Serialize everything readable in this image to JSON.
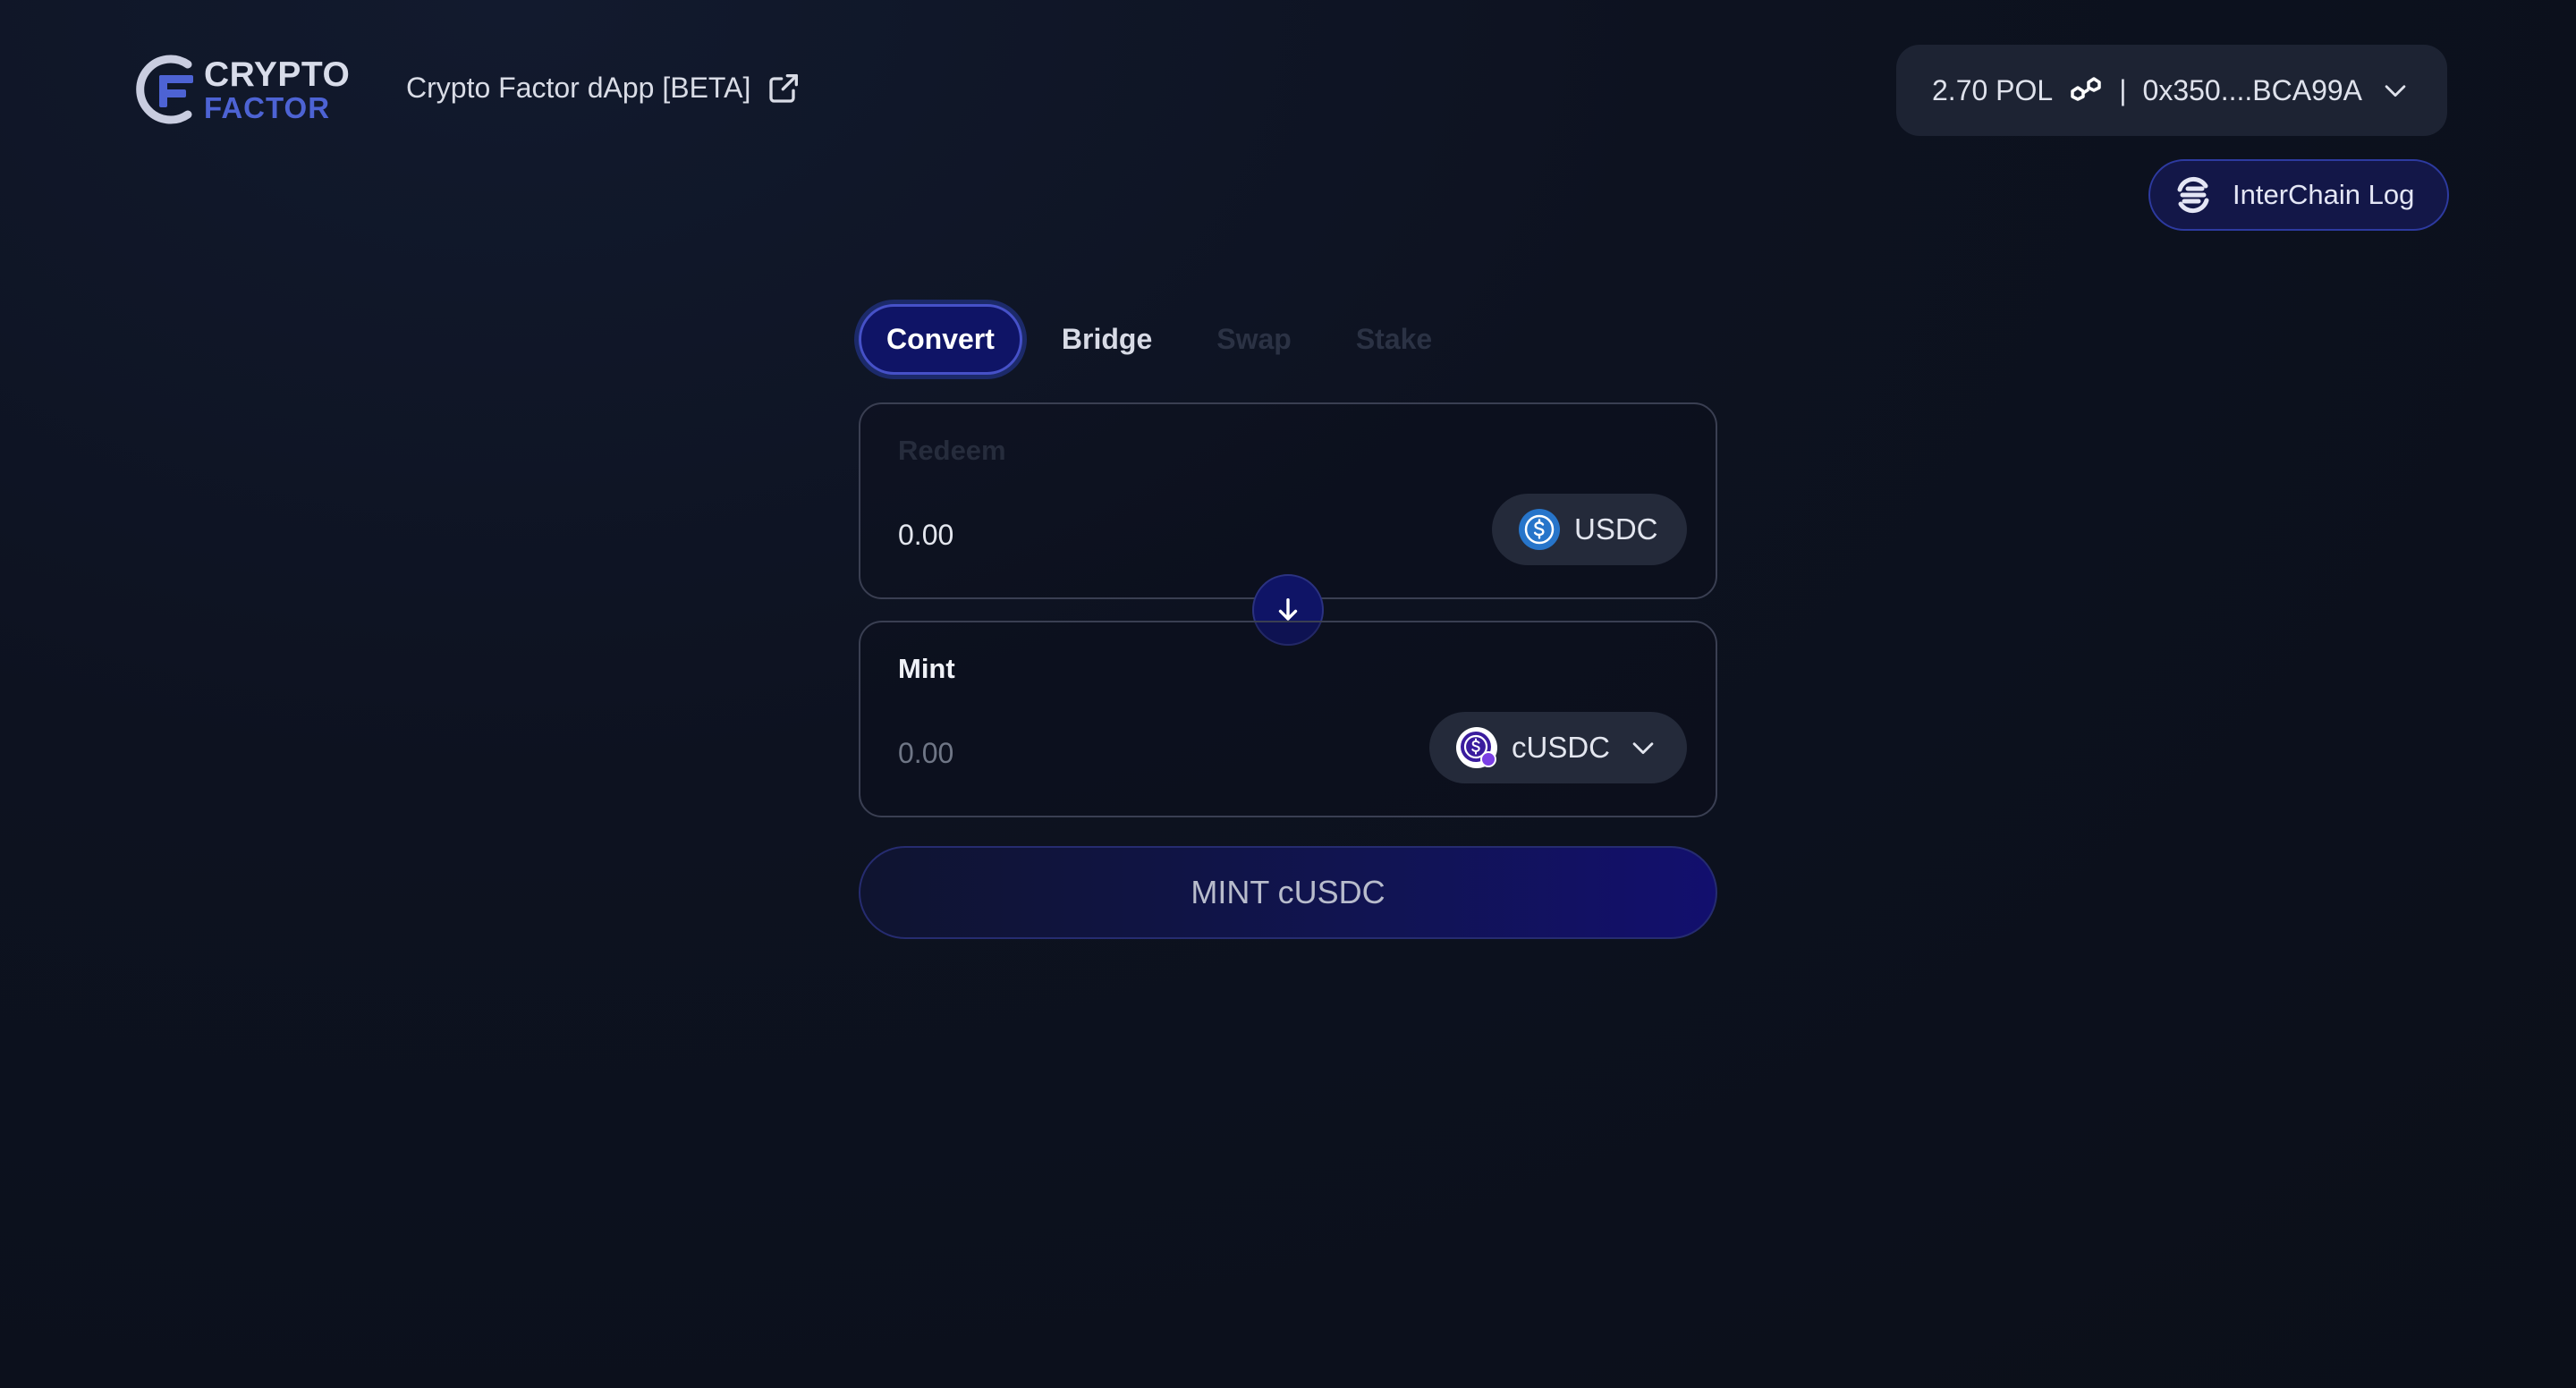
{
  "header": {
    "logo_line1": "CRYPTO",
    "logo_line2": "FACTOR",
    "dapp_label": "Crypto Factor dApp [BETA]"
  },
  "wallet": {
    "balance": "2.70 POL",
    "separator": "|",
    "address": "0x350....BCA99A"
  },
  "interchain": {
    "label": "InterChain Log"
  },
  "tabs": [
    {
      "label": "Convert",
      "state": "active"
    },
    {
      "label": "Bridge",
      "state": "enabled"
    },
    {
      "label": "Swap",
      "state": "disabled"
    },
    {
      "label": "Stake",
      "state": "disabled"
    }
  ],
  "redeem": {
    "label": "Redeem",
    "amount": "0.00",
    "token": "USDC"
  },
  "mint": {
    "label": "Mint",
    "amount_placeholder": "0.00",
    "token": "cUSDC"
  },
  "action": {
    "label": "MINT cUSDC"
  },
  "colors": {
    "accent": "#0f1466",
    "accent_border": "#4651c8",
    "logo_blue": "#4d63d4",
    "usdc_blue": "#2775ca",
    "cusdc_purple": "#7b3fe4"
  }
}
